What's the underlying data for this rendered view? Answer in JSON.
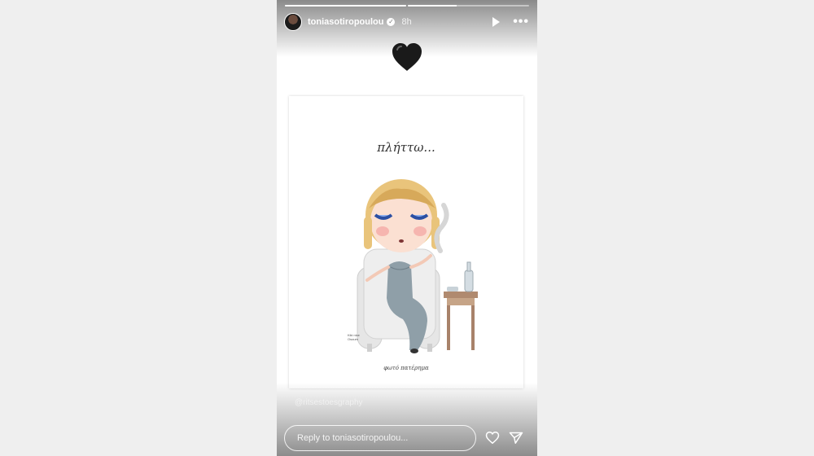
{
  "story": {
    "username": "toniasotiropoulou",
    "time": "8h",
    "verified_icon": "verified-badge-icon",
    "progress": [
      {
        "fill": 1.0
      },
      {
        "fill": 0.4
      }
    ],
    "sticker": "black-heart-icon"
  },
  "post": {
    "caption": "πλήττω...",
    "footer": "φωτό πατέρημα",
    "signature": "Kiki nice Osoum",
    "mention": "@ritsestoesgraphy"
  },
  "reply": {
    "placeholder": "Reply to toniasotiropoulou..."
  },
  "colors": {
    "page_background": "#efefef",
    "story_background": "#ffffff"
  }
}
